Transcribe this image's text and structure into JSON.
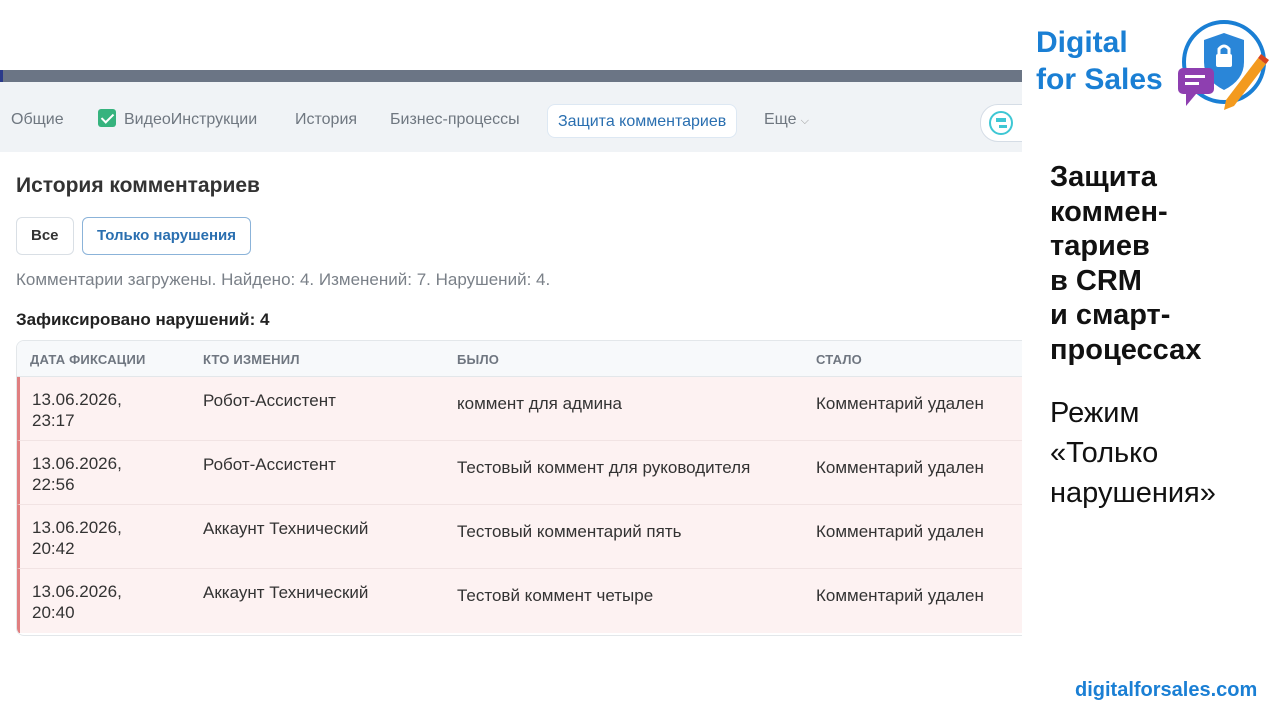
{
  "tabs": [
    {
      "label": "Общие"
    },
    {
      "label": "ВидеоИнструкции"
    },
    {
      "label": "История"
    },
    {
      "label": "Бизнес-процессы"
    },
    {
      "label": "Защита комментариев"
    },
    {
      "label": "Еще"
    }
  ],
  "history": {
    "title": "История комментариев",
    "filters": [
      "Все",
      "Только нарушения"
    ],
    "status": "Комментарии загружены. Найдено: 4. Изменений: 7. Нарушений: 4.",
    "violations_title": "Зафиксировано нарушений: 4"
  },
  "table": {
    "headers": [
      "ДАТА ФИКСАЦИИ",
      "КТО ИЗМЕНИЛ",
      "БЫЛО",
      "СТАЛО"
    ],
    "rows": [
      {
        "date": "13.06.2026,",
        "time": "23:17",
        "who": "Робот-Ассистент",
        "was": "коммент для админа",
        "became": "Комментарий удален"
      },
      {
        "date": "13.06.2026,",
        "time": "22:56",
        "who": "Робот-Ассистент",
        "was": "Тестовый коммент для руководителя",
        "became": "Комментарий удален"
      },
      {
        "date": "13.06.2026,",
        "time": "20:42",
        "who": "Аккаунт Технический",
        "was": "Тестовый комментарий пять",
        "became": "Комментарий удален"
      },
      {
        "date": "13.06.2026,",
        "time": "20:40",
        "who": "Аккаунт Технический",
        "was": "Тестовй коммент четыре",
        "became": "Комментарий удален"
      }
    ]
  },
  "brand": {
    "logo_line1": "Digital",
    "logo_line2": "for Sales",
    "headline": [
      "Защита",
      "коммен-",
      "тариев",
      "в CRM",
      "и смарт-",
      "процессах"
    ],
    "mode": [
      "Режим",
      "«Только",
      "нарушения»"
    ],
    "site": "digitalforsales.com"
  },
  "colors": {
    "accent_blue": "#1a7fd4",
    "violation_row_bg": "#fdf2f2",
    "violation_marker": "#e07f80",
    "active_tab_text": "#2a6fb0"
  },
  "icons": {
    "videoinstructions_tab": "green-checkbox-icon",
    "toolbar": "list-tool-icon",
    "logo": "shield-chat-pencil-logo"
  }
}
